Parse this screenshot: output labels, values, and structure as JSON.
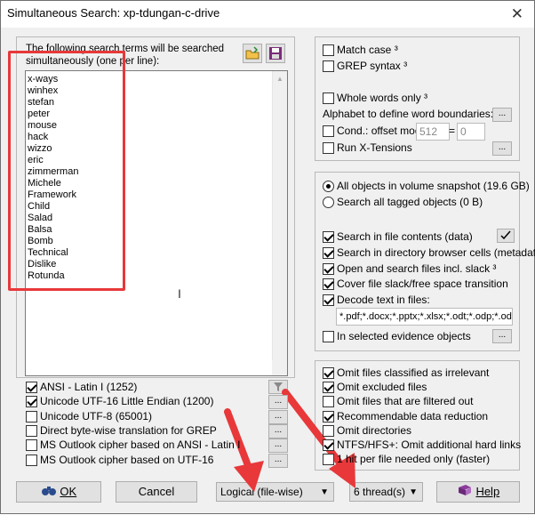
{
  "window": {
    "title": "Simultaneous Search: xp-tdungan-c-drive",
    "close_glyph": "✕"
  },
  "terms": {
    "caption": "The following search terms will be searched simultaneously (one per line):",
    "list": [
      "x-ways",
      "winhex",
      "stefan",
      "peter",
      "mouse",
      "hack",
      "wizzo",
      "eric",
      "zimmerman",
      "Michele",
      "Framework",
      "Child",
      "Salad",
      "Balsa",
      "Bomb",
      "Technical",
      "Dislike",
      "Rotunda"
    ]
  },
  "encodings": [
    {
      "label": "ANSI - Latin I (1252)",
      "checked": true
    },
    {
      "label": "Unicode UTF-16 Little Endian (1200)",
      "checked": true
    },
    {
      "label": "Unicode UTF-8 (65001)",
      "checked": false
    },
    {
      "label": "Direct byte-wise translation for GREP",
      "checked": false
    },
    {
      "label": "MS Outlook cipher based on ANSI - Latin I",
      "checked": false
    },
    {
      "label": "MS Outlook cipher based on UTF-16",
      "checked": false
    }
  ],
  "options": {
    "match_case": "Match case ³",
    "grep": "GREP syntax ³",
    "whole_words": "Whole words only ³",
    "alphabet": "Alphabet to define word boundaries:",
    "cond": "Cond.: offset mod",
    "cond_mod": "512",
    "cond_eq": "=",
    "cond_val": "0",
    "xtensions": "Run X-Tensions"
  },
  "scope": {
    "all_objects": "All objects in volume snapshot (19.6 GB)",
    "tagged": "Search all tagged objects (0 B)",
    "file_contents": "Search in file contents (data)",
    "dir_cells": "Search in directory browser cells (metadata)",
    "open_slack": "Open and search files incl. slack ³",
    "cover_slack": "Cover file slack/free space transition",
    "decode": "Decode text in files:",
    "decode_ext": "*.pdf;*.docx;*.pptx;*.xlsx;*.odt;*.odp;*.ods",
    "evidence": "In selected evidence objects"
  },
  "filters": [
    {
      "label": "Omit files classified as irrelevant",
      "checked": true
    },
    {
      "label": "Omit excluded files",
      "checked": true
    },
    {
      "label": "Omit files that are filtered out",
      "checked": false
    },
    {
      "label": "Recommendable data reduction",
      "checked": true
    },
    {
      "label": "Omit directories",
      "checked": false
    },
    {
      "label": "NTFS/HFS+: Omit additional hard links",
      "checked": true
    },
    {
      "label": "1 hit per file needed only (faster)",
      "checked": false
    }
  ],
  "buttons": {
    "ok": "OK",
    "cancel": "Cancel",
    "help": "Help",
    "dots": "..."
  },
  "dropdowns": {
    "mode": "Logical (file-wise)",
    "threads": "6 thread(s)"
  },
  "colors": {
    "annotation_red": "#e8383a"
  }
}
